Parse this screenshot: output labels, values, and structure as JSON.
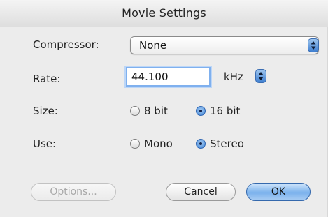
{
  "window": {
    "title": "Movie Settings"
  },
  "compressor": {
    "label": "Compressor:",
    "value": "None"
  },
  "rate": {
    "label": "Rate:",
    "value": "44.100",
    "unit": "kHz"
  },
  "size": {
    "label": "Size:",
    "options": [
      "8 bit",
      "16 bit"
    ],
    "selected": "16 bit"
  },
  "use": {
    "label": "Use:",
    "options": [
      "Mono",
      "Stereo"
    ],
    "selected": "Stereo"
  },
  "buttons": {
    "options": "Options...",
    "cancel": "Cancel",
    "ok": "OK"
  },
  "colors": {
    "accent": "#3a7fd2",
    "background": "#ececec"
  }
}
